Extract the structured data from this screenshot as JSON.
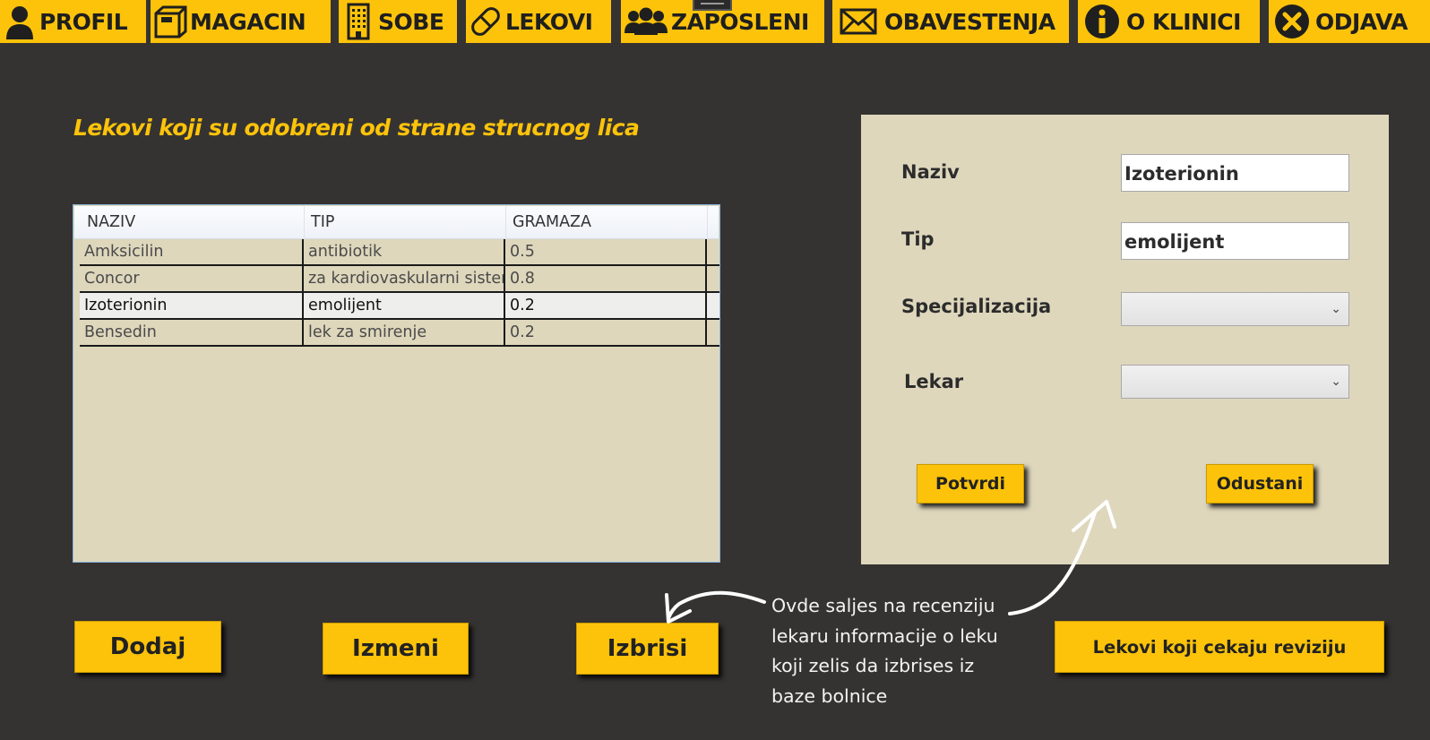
{
  "nav": {
    "profil": "PROFIL",
    "magacin": "MAGACIN",
    "sobe": "SOBE",
    "lekovi": "LEKOVI",
    "zaposleni": "ZAPOSLENI",
    "obavestenja": "OBAVESTENJA",
    "o_klinici": "O KLINICI",
    "odjava": "ODJAVA"
  },
  "heading": "Lekovi koji su odobreni od strane strucnog lica",
  "table": {
    "headers": [
      "NAZIV",
      "TIP",
      "GRAMAZA"
    ],
    "rows": [
      [
        "Amksicilin",
        "antibiotik",
        "0.5"
      ],
      [
        "Concor",
        "za kardiovaskularni sistem",
        "0.8"
      ],
      [
        "Izoterionin",
        "emolijent",
        "0.2"
      ],
      [
        "Bensedin",
        "lek za smirenje",
        "0.2"
      ]
    ],
    "selected_row": 2
  },
  "form": {
    "naziv_label": "Naziv",
    "naziv_value": "Izoterionin",
    "tip_label": "Tip",
    "tip_value": "emolijent",
    "specijalizacija_label": "Specijalizacija",
    "specijalizacija_value": "",
    "lekar_label": "Lekar",
    "lekar_value": "",
    "potvrdi": "Potvrdi",
    "odustani": "Odustani"
  },
  "buttons": {
    "dodaj": "Dodaj",
    "izmeni": "Izmeni",
    "izbrisi": "Izbrisi",
    "pending": "Lekovi koji cekaju reviziju"
  },
  "annotation": {
    "line1": "Ovde saljes na recenziju",
    "line2": "lekaru informacije o leku",
    "line3": "koji zelis da izbrises iz",
    "line4": "baze bolnice"
  },
  "colors": {
    "accent": "#fdc30a",
    "background": "#353332",
    "panel": "#ded7bc"
  },
  "icons": [
    "user-icon",
    "box-icon",
    "building-icon",
    "pill-icon",
    "group-icon",
    "envelope-icon",
    "info-icon",
    "close-circle-icon"
  ]
}
